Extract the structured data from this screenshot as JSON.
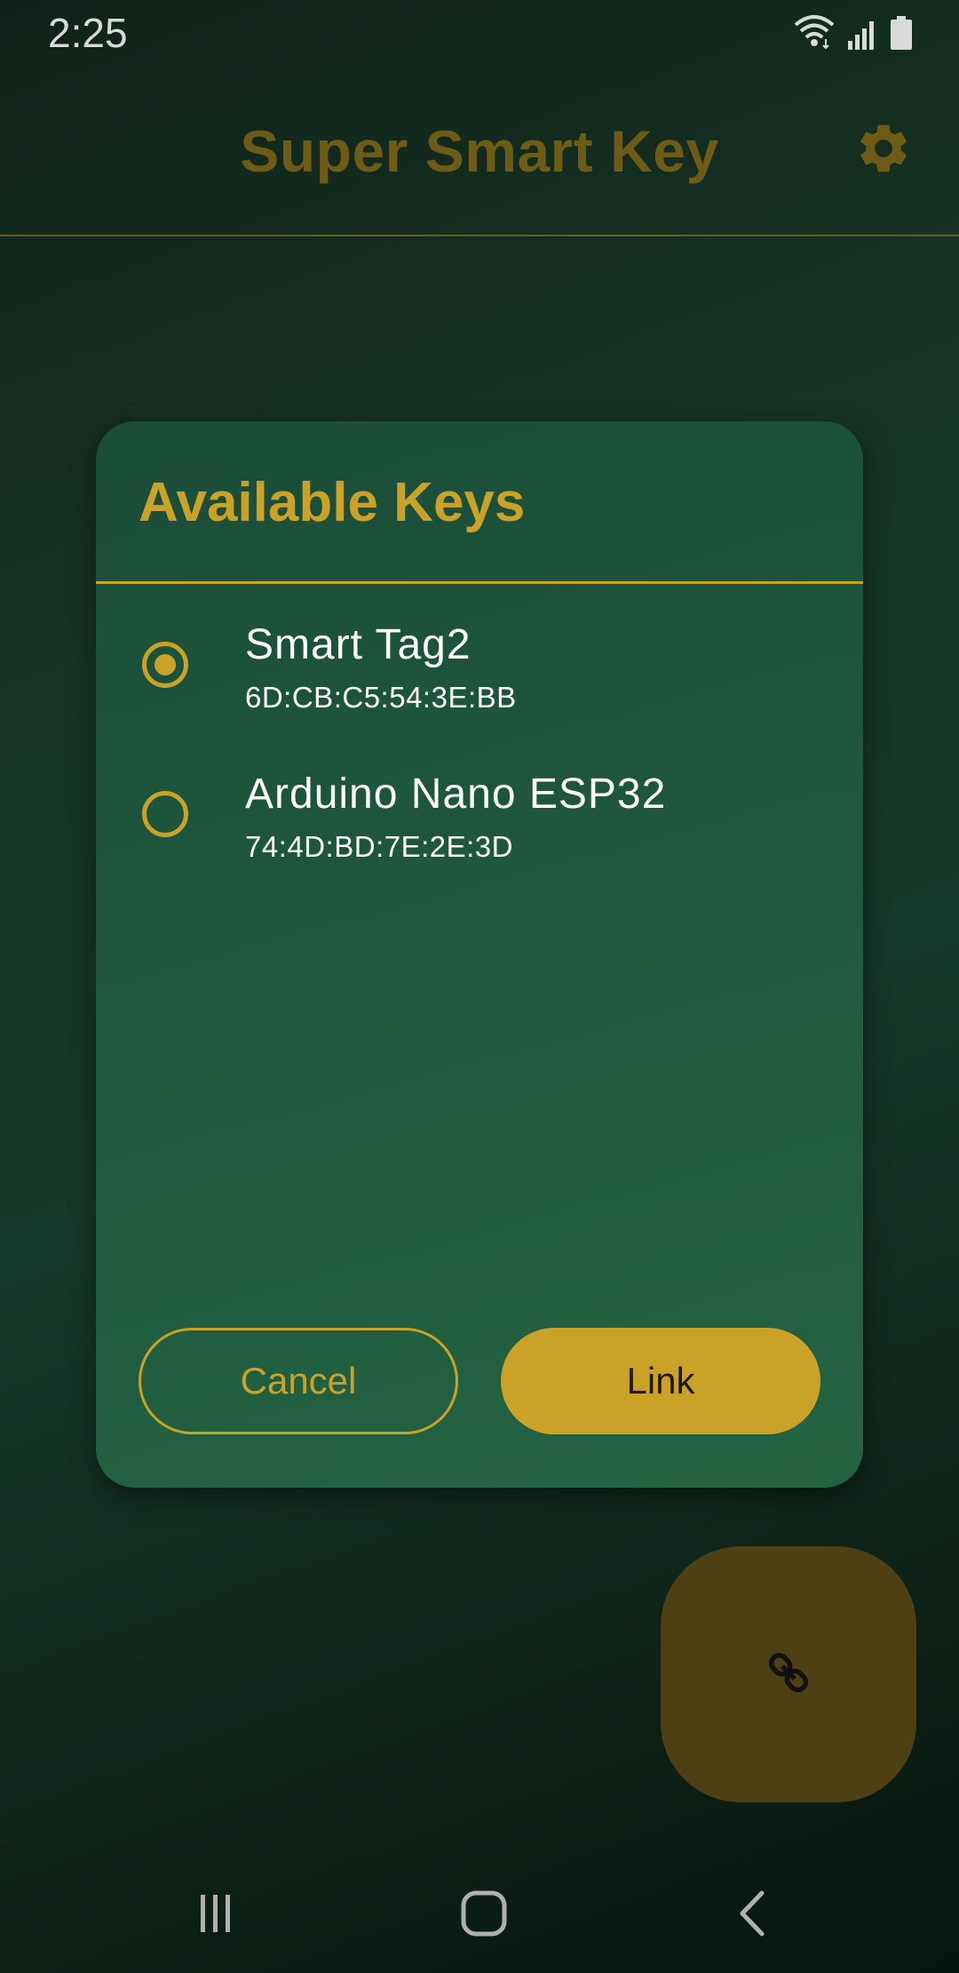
{
  "status_bar": {
    "time": "2:25",
    "icons": [
      "wifi-icon",
      "signal-icon",
      "battery-icon"
    ]
  },
  "app_bar": {
    "title": "Super Smart Key",
    "settings_icon": "gear-icon"
  },
  "dialog": {
    "title": "Available Keys",
    "keys": [
      {
        "name": "Smart Tag2",
        "mac": "6D:CB:C5:54:3E:BB",
        "selected": true
      },
      {
        "name": "Arduino Nano ESP32",
        "mac": "74:4D:BD:7E:2E:3D",
        "selected": false
      }
    ],
    "cancel_label": "Cancel",
    "link_label": "Link"
  },
  "fab": {
    "icon": "link-icon"
  },
  "nav_bar": {
    "icons": [
      "recent-apps-icon",
      "home-icon",
      "back-icon"
    ]
  },
  "colors": {
    "accent": "#c9a227",
    "dialog_bg": "#1f5b40",
    "background": "#0f2219"
  }
}
